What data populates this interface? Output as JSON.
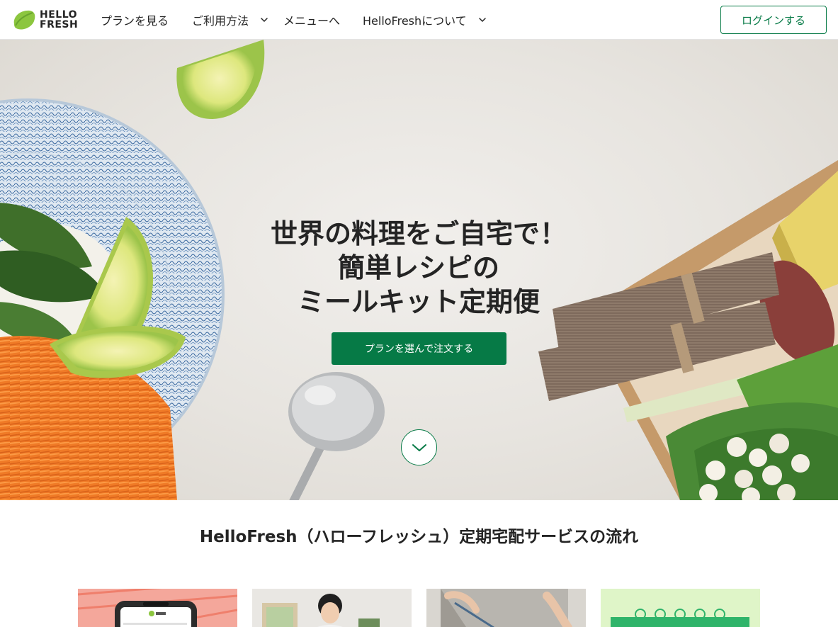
{
  "brand": {
    "logo_line1": "HELLO",
    "logo_line2": "FRESH",
    "primary_color": "#067a46",
    "logo_color": "#8cc63f"
  },
  "nav": {
    "items": [
      {
        "label": "プランを見る",
        "has_dropdown": false
      },
      {
        "label": "ご利用方法",
        "has_dropdown": true
      },
      {
        "label": "メニューへ",
        "has_dropdown": false
      },
      {
        "label": "HelloFreshについて",
        "has_dropdown": true
      }
    ],
    "login_label": "ログインする"
  },
  "hero": {
    "title_lines": [
      "世界の料理をご自宅で！",
      "簡単レシピの",
      "ミールキット定期便"
    ],
    "cta_label": "プランを選んで注文する",
    "scroll_icon": "chevron-down-icon"
  },
  "section": {
    "title": "HelloFresh（ハローフレッシュ）定期宅配サービスの流れ"
  }
}
